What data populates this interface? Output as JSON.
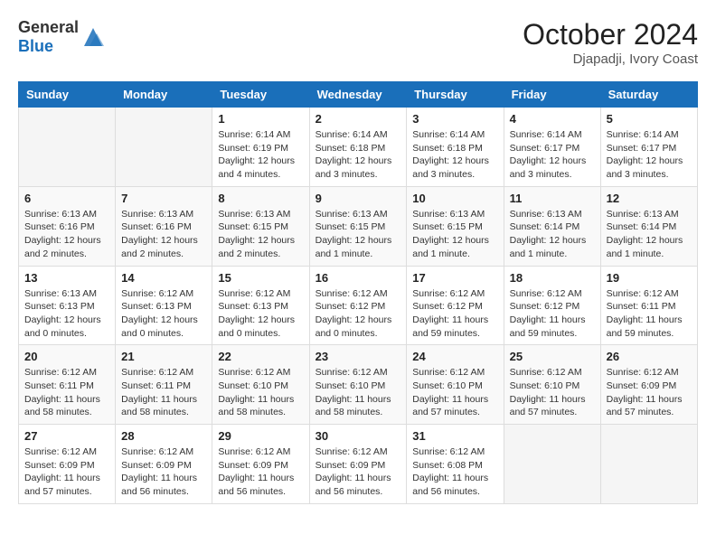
{
  "header": {
    "logo_general": "General",
    "logo_blue": "Blue",
    "month_year": "October 2024",
    "location": "Djapadji, Ivory Coast"
  },
  "days_of_week": [
    "Sunday",
    "Monday",
    "Tuesday",
    "Wednesday",
    "Thursday",
    "Friday",
    "Saturday"
  ],
  "weeks": [
    [
      {
        "day": "",
        "info": ""
      },
      {
        "day": "",
        "info": ""
      },
      {
        "day": "1",
        "info": "Sunrise: 6:14 AM\nSunset: 6:19 PM\nDaylight: 12 hours and 4 minutes."
      },
      {
        "day": "2",
        "info": "Sunrise: 6:14 AM\nSunset: 6:18 PM\nDaylight: 12 hours and 3 minutes."
      },
      {
        "day": "3",
        "info": "Sunrise: 6:14 AM\nSunset: 6:18 PM\nDaylight: 12 hours and 3 minutes."
      },
      {
        "day": "4",
        "info": "Sunrise: 6:14 AM\nSunset: 6:17 PM\nDaylight: 12 hours and 3 minutes."
      },
      {
        "day": "5",
        "info": "Sunrise: 6:14 AM\nSunset: 6:17 PM\nDaylight: 12 hours and 3 minutes."
      }
    ],
    [
      {
        "day": "6",
        "info": "Sunrise: 6:13 AM\nSunset: 6:16 PM\nDaylight: 12 hours and 2 minutes."
      },
      {
        "day": "7",
        "info": "Sunrise: 6:13 AM\nSunset: 6:16 PM\nDaylight: 12 hours and 2 minutes."
      },
      {
        "day": "8",
        "info": "Sunrise: 6:13 AM\nSunset: 6:15 PM\nDaylight: 12 hours and 2 minutes."
      },
      {
        "day": "9",
        "info": "Sunrise: 6:13 AM\nSunset: 6:15 PM\nDaylight: 12 hours and 1 minute."
      },
      {
        "day": "10",
        "info": "Sunrise: 6:13 AM\nSunset: 6:15 PM\nDaylight: 12 hours and 1 minute."
      },
      {
        "day": "11",
        "info": "Sunrise: 6:13 AM\nSunset: 6:14 PM\nDaylight: 12 hours and 1 minute."
      },
      {
        "day": "12",
        "info": "Sunrise: 6:13 AM\nSunset: 6:14 PM\nDaylight: 12 hours and 1 minute."
      }
    ],
    [
      {
        "day": "13",
        "info": "Sunrise: 6:13 AM\nSunset: 6:13 PM\nDaylight: 12 hours and 0 minutes."
      },
      {
        "day": "14",
        "info": "Sunrise: 6:12 AM\nSunset: 6:13 PM\nDaylight: 12 hours and 0 minutes."
      },
      {
        "day": "15",
        "info": "Sunrise: 6:12 AM\nSunset: 6:13 PM\nDaylight: 12 hours and 0 minutes."
      },
      {
        "day": "16",
        "info": "Sunrise: 6:12 AM\nSunset: 6:12 PM\nDaylight: 12 hours and 0 minutes."
      },
      {
        "day": "17",
        "info": "Sunrise: 6:12 AM\nSunset: 6:12 PM\nDaylight: 11 hours and 59 minutes."
      },
      {
        "day": "18",
        "info": "Sunrise: 6:12 AM\nSunset: 6:12 PM\nDaylight: 11 hours and 59 minutes."
      },
      {
        "day": "19",
        "info": "Sunrise: 6:12 AM\nSunset: 6:11 PM\nDaylight: 11 hours and 59 minutes."
      }
    ],
    [
      {
        "day": "20",
        "info": "Sunrise: 6:12 AM\nSunset: 6:11 PM\nDaylight: 11 hours and 58 minutes."
      },
      {
        "day": "21",
        "info": "Sunrise: 6:12 AM\nSunset: 6:11 PM\nDaylight: 11 hours and 58 minutes."
      },
      {
        "day": "22",
        "info": "Sunrise: 6:12 AM\nSunset: 6:10 PM\nDaylight: 11 hours and 58 minutes."
      },
      {
        "day": "23",
        "info": "Sunrise: 6:12 AM\nSunset: 6:10 PM\nDaylight: 11 hours and 58 minutes."
      },
      {
        "day": "24",
        "info": "Sunrise: 6:12 AM\nSunset: 6:10 PM\nDaylight: 11 hours and 57 minutes."
      },
      {
        "day": "25",
        "info": "Sunrise: 6:12 AM\nSunset: 6:10 PM\nDaylight: 11 hours and 57 minutes."
      },
      {
        "day": "26",
        "info": "Sunrise: 6:12 AM\nSunset: 6:09 PM\nDaylight: 11 hours and 57 minutes."
      }
    ],
    [
      {
        "day": "27",
        "info": "Sunrise: 6:12 AM\nSunset: 6:09 PM\nDaylight: 11 hours and 57 minutes."
      },
      {
        "day": "28",
        "info": "Sunrise: 6:12 AM\nSunset: 6:09 PM\nDaylight: 11 hours and 56 minutes."
      },
      {
        "day": "29",
        "info": "Sunrise: 6:12 AM\nSunset: 6:09 PM\nDaylight: 11 hours and 56 minutes."
      },
      {
        "day": "30",
        "info": "Sunrise: 6:12 AM\nSunset: 6:09 PM\nDaylight: 11 hours and 56 minutes."
      },
      {
        "day": "31",
        "info": "Sunrise: 6:12 AM\nSunset: 6:08 PM\nDaylight: 11 hours and 56 minutes."
      },
      {
        "day": "",
        "info": ""
      },
      {
        "day": "",
        "info": ""
      }
    ]
  ]
}
